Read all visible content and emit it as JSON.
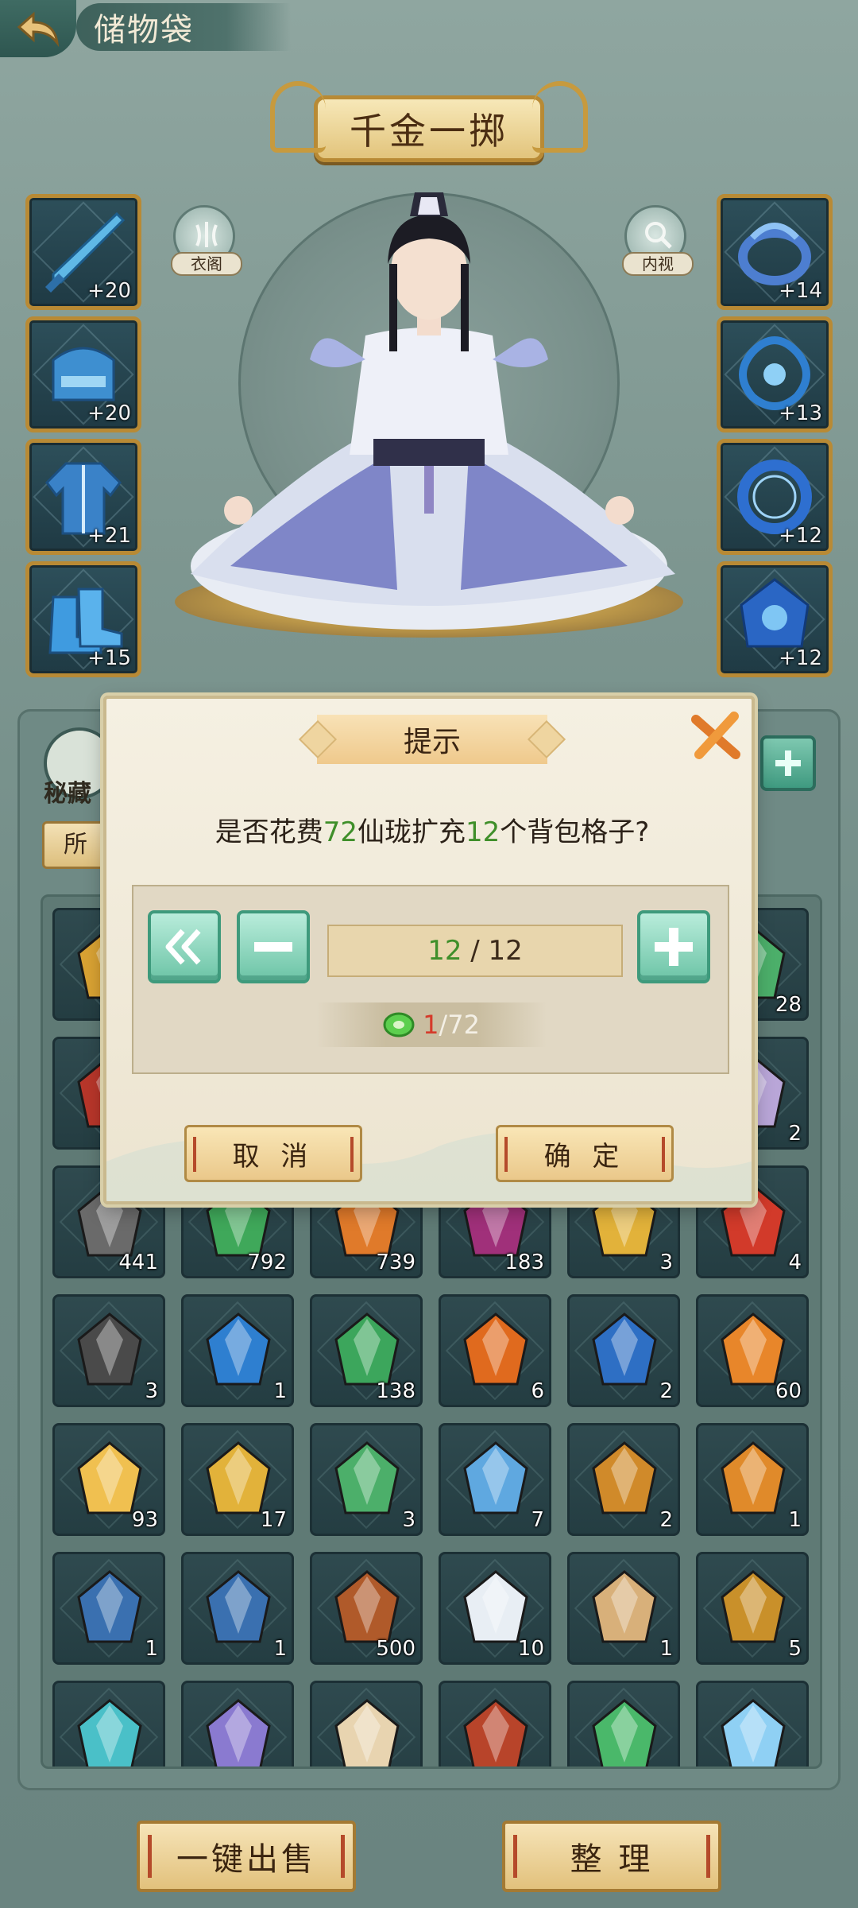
{
  "header": {
    "back_icon": "back-arrow-icon",
    "title": "储物袋"
  },
  "hero": {
    "rank_title": "千金一掷",
    "wardrobe_label": "衣阁",
    "inspect_label": "内视",
    "left_equipment": [
      {
        "name": "sword-icon",
        "level": "+20"
      },
      {
        "name": "helmet-icon",
        "level": "+20"
      },
      {
        "name": "robe-icon",
        "level": "+21"
      },
      {
        "name": "boots-icon",
        "level": "+15"
      }
    ],
    "right_equipment": [
      {
        "name": "ring-icon",
        "level": "+14"
      },
      {
        "name": "pendant-icon",
        "level": "+13"
      },
      {
        "name": "bracelet-icon",
        "level": "+12"
      },
      {
        "name": "amulet-icon",
        "level": "+12"
      }
    ]
  },
  "bag": {
    "tab_label": "秘藏",
    "filter_label": "所",
    "rows": [
      [
        {
          "icon": "golden-dragon-icon",
          "count": ""
        },
        {
          "icon": "",
          "count": ""
        },
        {
          "icon": "",
          "count": ""
        },
        {
          "icon": "",
          "count": ""
        },
        {
          "icon": "",
          "count": ""
        },
        {
          "icon": "green-jade-icon",
          "count": "28"
        }
      ],
      [
        {
          "icon": "red-gourd-icon",
          "count": ""
        },
        {
          "icon": "",
          "count": ""
        },
        {
          "icon": "",
          "count": ""
        },
        {
          "icon": "",
          "count": ""
        },
        {
          "icon": "",
          "count": ""
        },
        {
          "icon": "lotus-icon",
          "count": "2"
        }
      ],
      [
        {
          "icon": "grey-ore-icon",
          "count": "441"
        },
        {
          "icon": "green-crystal-icon",
          "count": "792"
        },
        {
          "icon": "orange-crystal-icon",
          "count": "739"
        },
        {
          "icon": "purple-crystal-icon",
          "count": "183"
        },
        {
          "icon": "yellow-crystal-icon",
          "count": "3"
        },
        {
          "icon": "red-crystal-icon",
          "count": "4"
        }
      ],
      [
        {
          "icon": "dark-ore-icon",
          "count": "3"
        },
        {
          "icon": "blue-crystal-icon",
          "count": "1"
        },
        {
          "icon": "green-talisman-icon",
          "count": "138"
        },
        {
          "icon": "fire-talisman-icon",
          "count": "6"
        },
        {
          "icon": "water-orb-icon",
          "count": "2"
        },
        {
          "icon": "fire-crystal-icon",
          "count": "60"
        }
      ],
      [
        {
          "icon": "gold-crystal-icon",
          "count": "93"
        },
        {
          "icon": "metal-element-icon",
          "count": "17"
        },
        {
          "icon": "wood-element-icon",
          "count": "3"
        },
        {
          "icon": "water-element-icon",
          "count": "7"
        },
        {
          "icon": "earth-element-icon",
          "count": "2"
        },
        {
          "icon": "orange-book-icon",
          "count": "1"
        }
      ],
      [
        {
          "icon": "blue-book-icon",
          "count": "1"
        },
        {
          "icon": "blue-book-icon",
          "count": "1"
        },
        {
          "icon": "mushroom-icon",
          "count": "500"
        },
        {
          "icon": "vase-icon",
          "count": "10"
        },
        {
          "icon": "money-bag-icon",
          "count": "1"
        },
        {
          "icon": "gold-ingot-icon",
          "count": "5"
        }
      ],
      [
        {
          "icon": "teal-crystal-icon",
          "count": ""
        },
        {
          "icon": "violet-crystal-icon",
          "count": ""
        },
        {
          "icon": "scroll-icon",
          "count": ""
        },
        {
          "icon": "red-box-icon",
          "count": ""
        },
        {
          "icon": "green-gem-icon",
          "count": ""
        },
        {
          "icon": "ice-crystal-icon",
          "count": ""
        }
      ]
    ],
    "sell_all_label": "一键出售",
    "sort_label": "整 理"
  },
  "dialog": {
    "title": "提示",
    "question_prefix": "是否花费",
    "question_cost": "72",
    "question_mid": "仙珑扩充",
    "question_slots": "12",
    "question_suffix": "个背包格子?",
    "max_icon": "double-chevron-left-icon",
    "minus_icon": "minus-icon",
    "plus_icon": "plus-icon",
    "count_current": "12",
    "count_sep": " / ",
    "count_max": "12",
    "currency_icon": "jade-coin-icon",
    "owned": "1",
    "cost": "/72",
    "cancel_label": "取 消",
    "confirm_label": "确 定"
  },
  "colors": {
    "accent_green": "#3f8f2a",
    "cost_red": "#d53a2a",
    "gold_border": "#b88a35",
    "teal_button": "#6cc4a6"
  }
}
